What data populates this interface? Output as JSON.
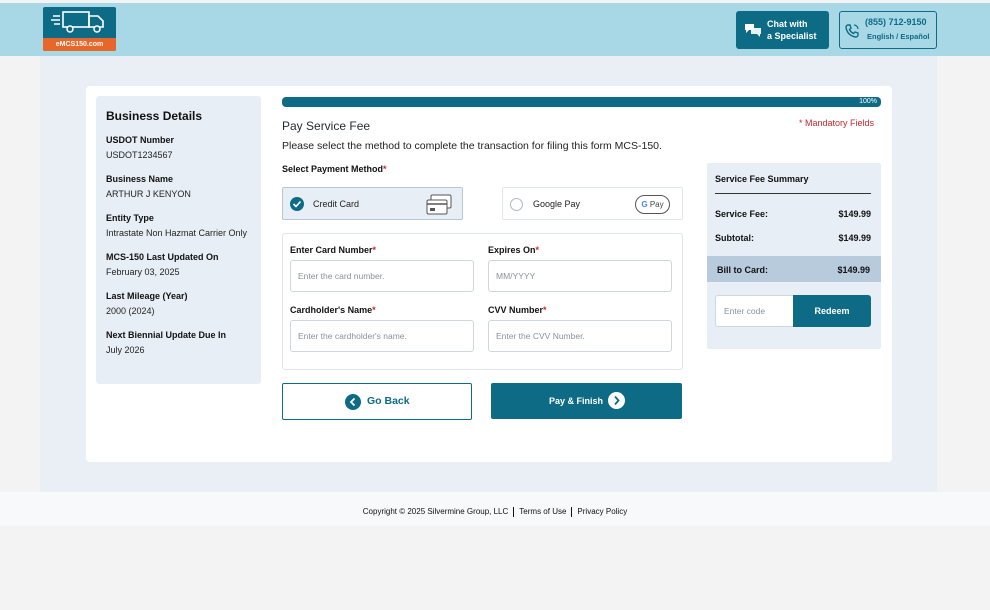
{
  "header": {
    "logo_text": "eMCS150.com",
    "chat_button": {
      "line1": "Chat with",
      "line2": "a Specialist"
    },
    "phone": {
      "number": "(855) 712-9150",
      "languages": "English / Español"
    }
  },
  "business_details": {
    "title": "Business Details",
    "fields": [
      {
        "label": "USDOT Number",
        "value": "USDOT1234567"
      },
      {
        "label": "Business Name",
        "value": "ARTHUR J KENYON"
      },
      {
        "label": "Entity Type",
        "value": "Intrastate Non Hazmat Carrier Only"
      },
      {
        "label": "MCS-150 Last Updated On",
        "value": "February 03, 2025"
      },
      {
        "label": "Last Mileage (Year)",
        "value": "2000 (2024)"
      },
      {
        "label": "Next Biennial Update Due In",
        "value": "July 2026"
      }
    ]
  },
  "progress": {
    "value": 1.0,
    "label": "100%"
  },
  "page": {
    "title": "Pay Service Fee",
    "mandatory_note": "* Mandatory Fields",
    "subtitle": "Please select the method to complete the transaction for filing this form MCS-150.",
    "payment_method_label": "Select Payment Method",
    "required_mark": "*"
  },
  "payment_options": {
    "credit_card": {
      "label": "Credit Card",
      "selected": true
    },
    "google_pay": {
      "label": "Google Pay",
      "badge_g": "G",
      "badge_text": "Pay",
      "selected": false
    }
  },
  "form": {
    "card_number": {
      "label": "Enter Card Number",
      "placeholder": "Enter the card number."
    },
    "expires": {
      "label": "Expires On",
      "placeholder": "MM/YYYY"
    },
    "cardholder": {
      "label": "Cardholder's Name",
      "placeholder": "Enter the cardholder's name."
    },
    "cvv": {
      "label": "CVV Number",
      "placeholder": "Enter the CVV Number."
    }
  },
  "buttons": {
    "back": "Go Back",
    "pay": "Pay & Finish"
  },
  "summary": {
    "title": "Service Fee Summary",
    "service_fee": {
      "label": "Service Fee:",
      "amount": "$149.99"
    },
    "subtotal": {
      "label": "Subtotal:",
      "amount": "$149.99"
    },
    "bill_to_card": {
      "label": "Bill to Card:",
      "amount": "$149.99"
    },
    "code_placeholder": "Enter code",
    "redeem_label": "Redeem"
  },
  "footer": {
    "copyright": "Copyright © 2025 Silvermine Group, LLC",
    "terms": "Terms of Use",
    "privacy": "Privacy Policy"
  },
  "colors": {
    "primary": "#0e6b86",
    "header_bg": "#a8d8e6",
    "accent": "#e8662a",
    "required": "#c8282f"
  }
}
